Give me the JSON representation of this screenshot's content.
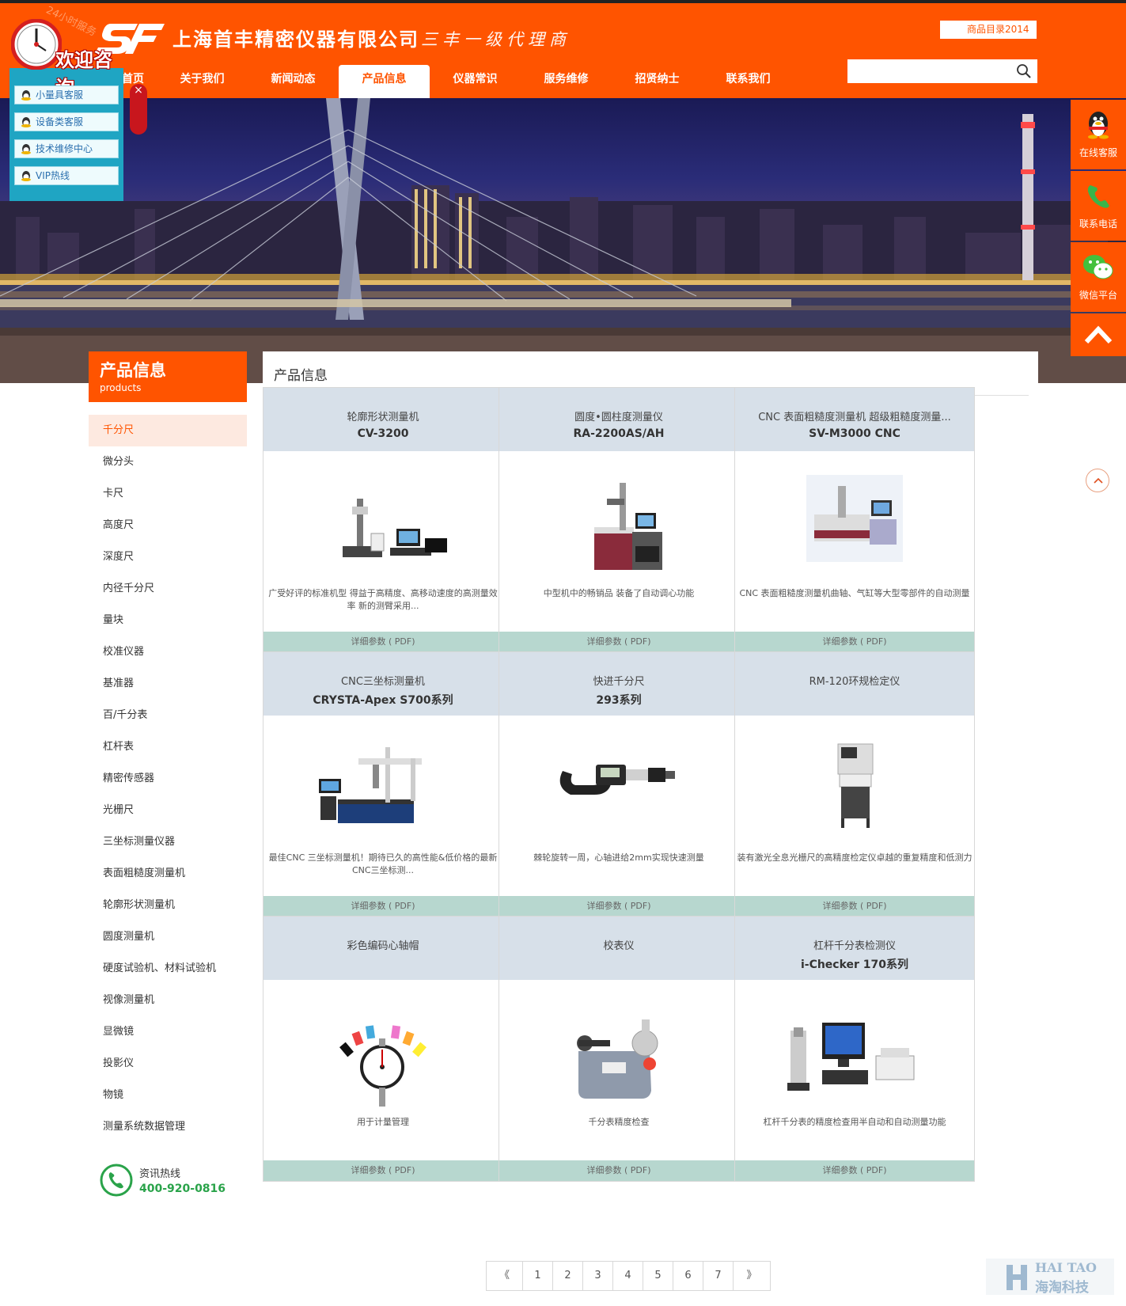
{
  "header": {
    "company_name": "上海首丰精密仪器有限公司",
    "slogan": "三丰一级代理商",
    "catalog_label": "商品目录2014",
    "search_placeholder": "",
    "brand_color": "#ff5400"
  },
  "nav": {
    "items": [
      "首页",
      "关于我们",
      "新闻动态",
      "产品信息",
      "仪器常识",
      "服务维修",
      "招贤纳士",
      "联系我们"
    ],
    "active": "产品信息"
  },
  "consult": {
    "badge": "24小时服务",
    "title": "欢迎咨询",
    "items": [
      "小量具客服",
      "设备类客服",
      "技术维修中心",
      "VIP热线"
    ]
  },
  "right_bar": {
    "items": [
      {
        "label": "在线客服",
        "icon": "qq-penguin-icon"
      },
      {
        "label": "联系电话",
        "icon": "phone-icon"
      },
      {
        "label": "微信平台",
        "icon": "wechat-icon"
      }
    ]
  },
  "sidebar": {
    "title": "产品信息",
    "subtitle": "products",
    "categories": [
      "千分尺",
      "微分头",
      "卡尺",
      "高度尺",
      "深度尺",
      "内径千分尺",
      "量块",
      "校准仪器",
      "基准器",
      "百/千分表",
      "杠杆表",
      "精密传感器",
      "光栅尺",
      "三坐标测量仪器",
      "表面粗糙度测量机",
      "轮廓形状测量机",
      "圆度测量机",
      "硬度试验机、材料试验机",
      "视像测量机",
      "显微镜",
      "投影仪",
      "物镜",
      "测量系统数据管理"
    ],
    "active": "千分尺",
    "hotline_label": "资讯热线",
    "hotline_number": "400-920-0816"
  },
  "main": {
    "title": "产品信息",
    "detail_label": "详细参数 ( PDF)",
    "products": [
      {
        "name": "轮廓形状测量机",
        "model": "CV-3200",
        "desc": "广受好评的标准机型 得益于高精度、高移动速度的高测量效率 新的测臂采用...",
        "icon": "contour-machine-icon"
      },
      {
        "name": "圆度•圆柱度测量仪",
        "model": "RA-2200AS/AH",
        "desc": "中型机中的畅销品 装备了自动调心功能",
        "icon": "roundness-tester-icon"
      },
      {
        "name": "CNC 表面粗糙度测量机 超级粗糙度测量...",
        "model": "SV-M3000 CNC",
        "desc": "CNC 表面粗糙度测量机曲轴、气缸等大型零部件的自动测量",
        "icon": "surface-tester-icon"
      },
      {
        "name": "CNC三坐标测量机",
        "model": "CRYSTA-Apex S700系列",
        "desc": "最佳CNC 三坐标测量机！期待已久的高性能&低价格的最新CNC三坐标测...",
        "icon": "cmm-icon"
      },
      {
        "name": "快进千分尺",
        "model": "293系列",
        "desc": "棘轮旋转一周，心轴进给2mm实现快速测量",
        "icon": "micrometer-icon"
      },
      {
        "name": "RM-120环规检定仪",
        "model": "",
        "desc": "装有激光全息光栅尺的高精度检定仪卓越的重复精度和低测力",
        "icon": "ring-gauge-tester-icon"
      },
      {
        "name": "彩色编码心轴帽",
        "model": "",
        "desc": "用于计量管理",
        "icon": "dial-gauge-caps-icon"
      },
      {
        "name": "校表仪",
        "model": "",
        "desc": "千分表精度检查",
        "icon": "gauge-calibrator-icon"
      },
      {
        "name": "杠杆千分表检测仪",
        "model": "i-Checker 170系列",
        "desc": "杠杆千分表的精度检查用半自动和自动测量功能",
        "icon": "i-checker-icon"
      }
    ]
  },
  "pager": {
    "prev": "《",
    "next": "》",
    "pages": [
      "1",
      "2",
      "3",
      "4",
      "5",
      "6",
      "7"
    ]
  },
  "watermark": {
    "en": "HAI TAO",
    "cn": "海淘科技"
  }
}
